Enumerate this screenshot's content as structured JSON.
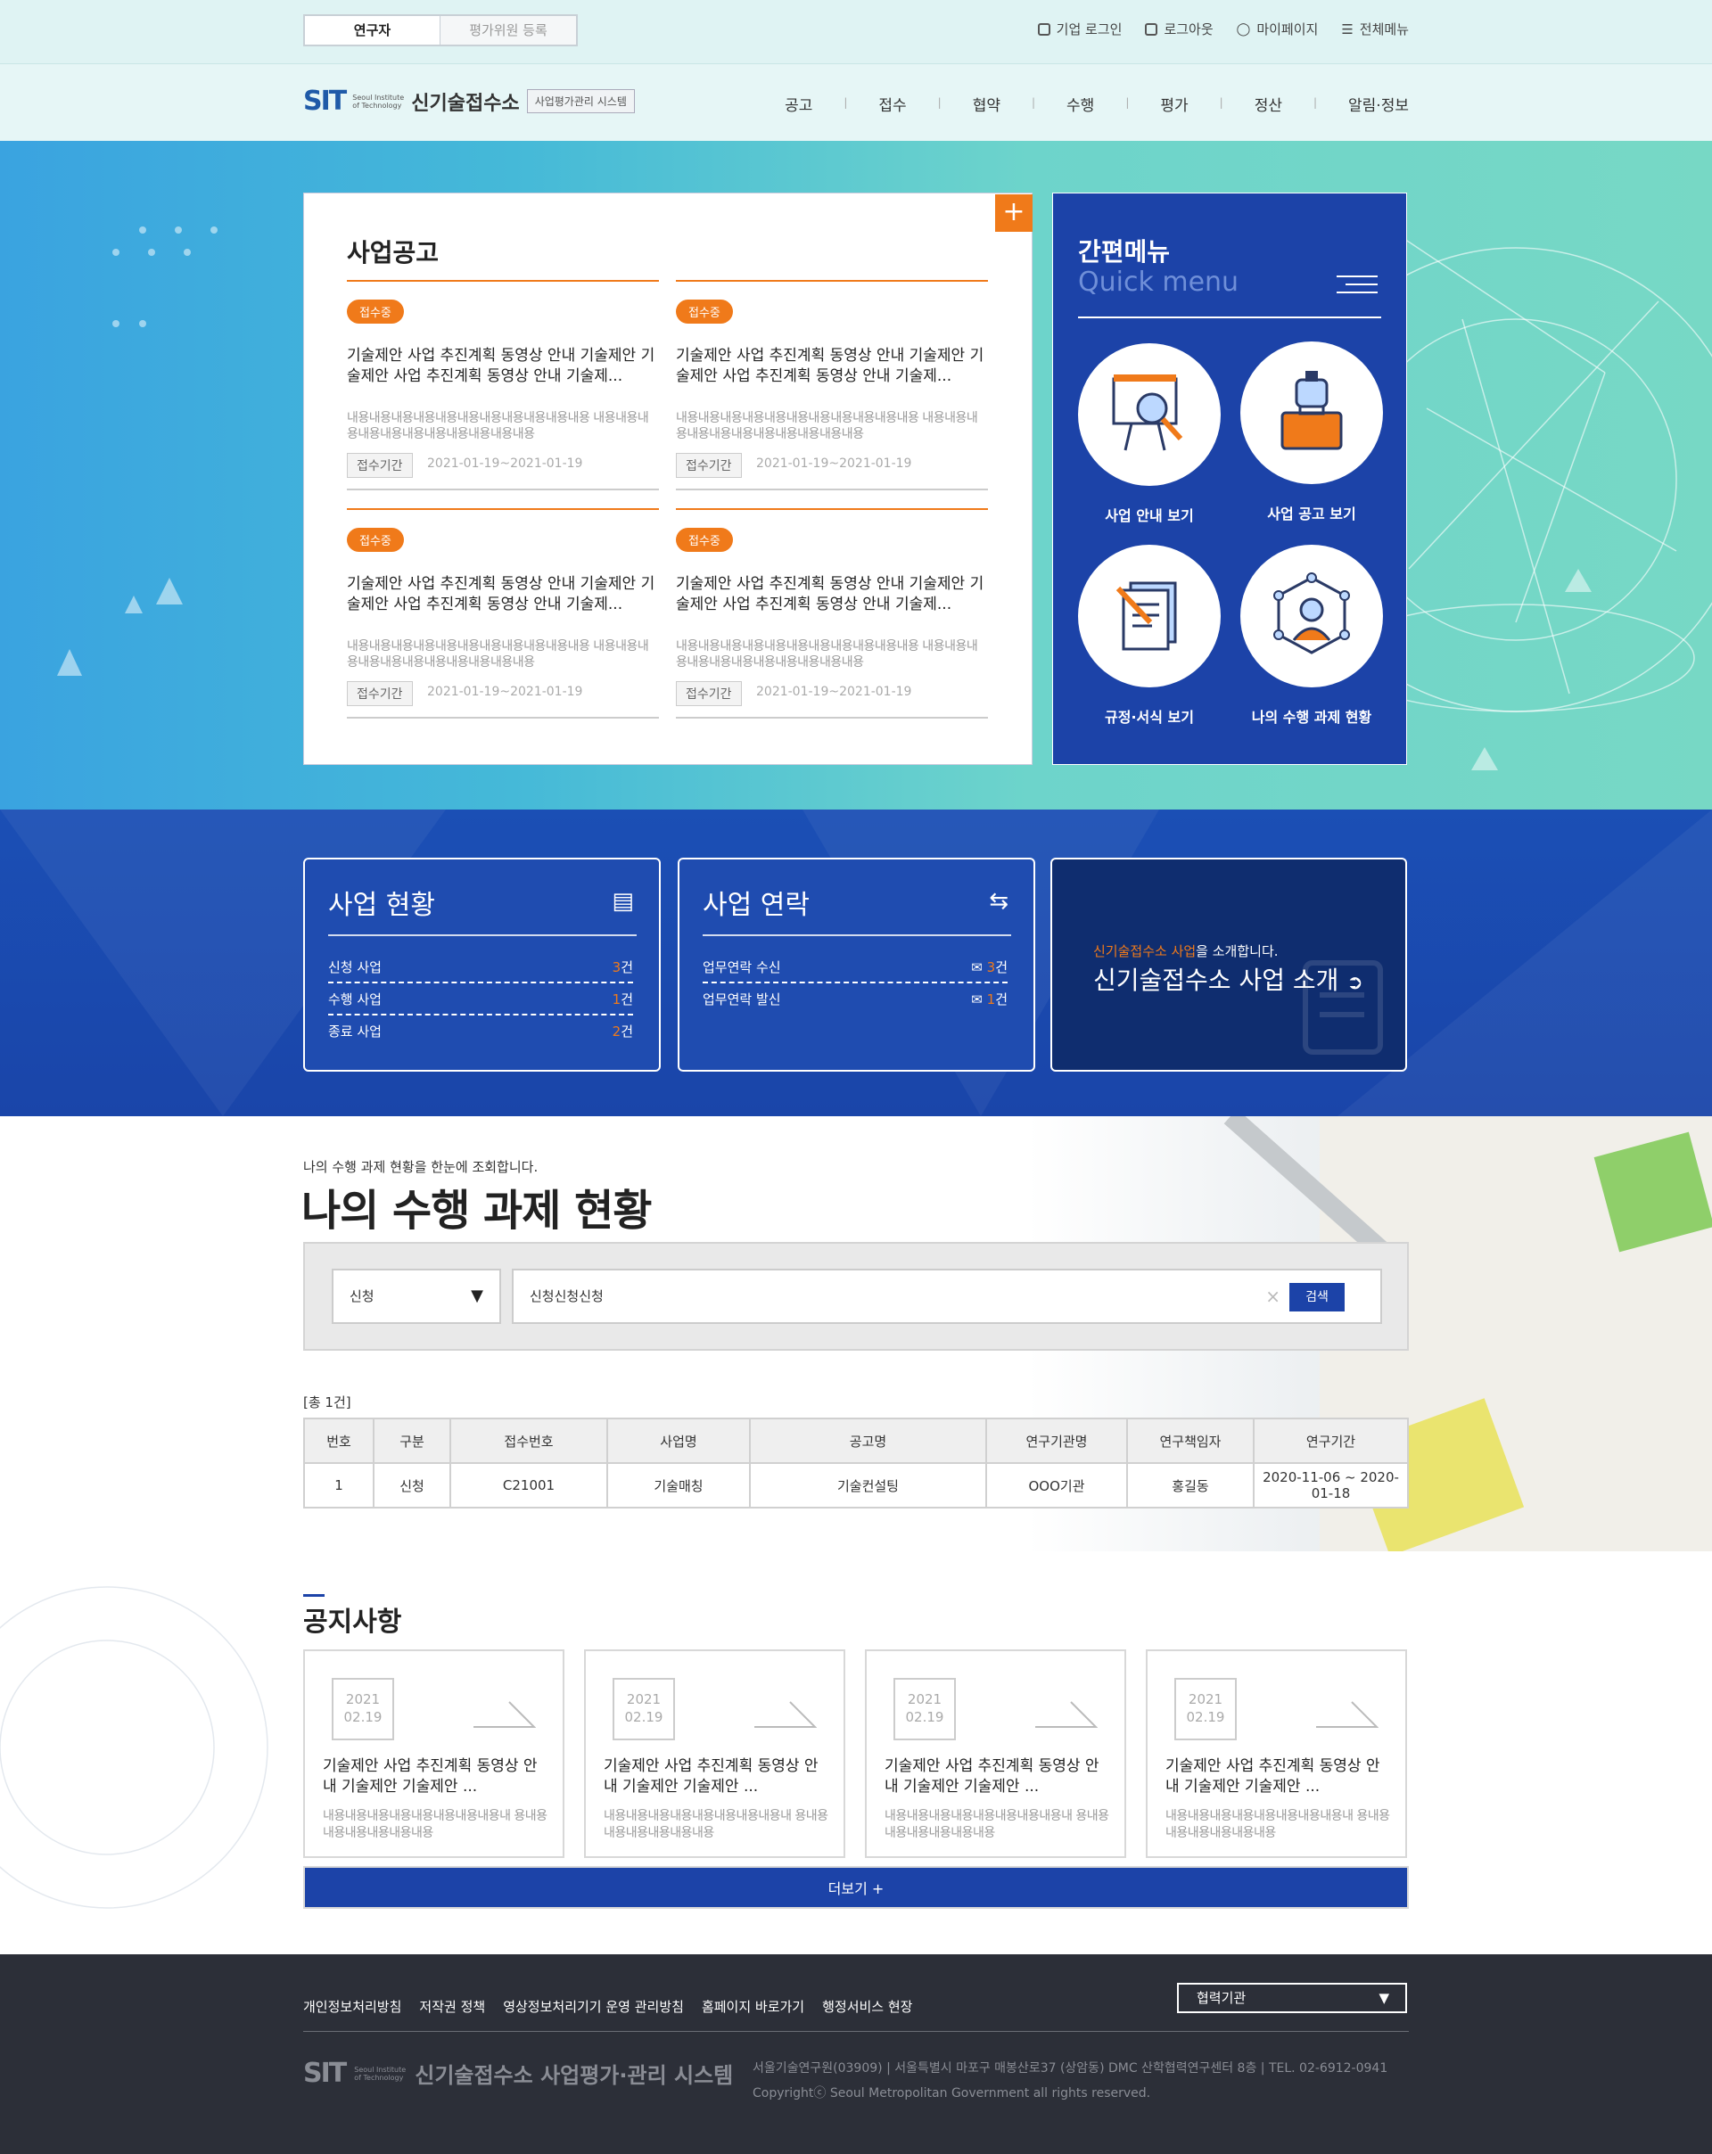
{
  "header": {
    "toggle": [
      "연구자",
      "평가위원 등록"
    ],
    "util": [
      "기업 로그인",
      "로그아웃",
      "마이페이지",
      "전체메뉴"
    ],
    "logo_mark": "SIT",
    "logo_sub": "Seoul Institute of Technology",
    "logo_name": "신기술접수소",
    "logo_tag": "사업평가관리 시스템",
    "gnb": [
      "공고",
      "접수",
      "협약",
      "수행",
      "평가",
      "정산",
      "알림·정보"
    ]
  },
  "notice_board": {
    "title": "사업공고",
    "plus": "+",
    "items": [
      {
        "badge": "접수중",
        "title": "기술제안 사업 추진계획 동영상 안내 기술제안 기술제안 사업 추진계획 동영상 안내 기술제...",
        "desc": "내용내용내용내용내용내용내용내용내용내용내용 내용내용내용내용내용내용내용내용내용내용내용",
        "tag": "접수기간",
        "date": "2021-01-19~2021-01-19"
      },
      {
        "badge": "접수중",
        "title": "기술제안 사업 추진계획 동영상 안내 기술제안 기술제안 사업 추진계획 동영상 안내 기술제...",
        "desc": "내용내용내용내용내용내용내용내용내용내용내용 내용내용내용내용내용내용내용내용내용내용내용",
        "tag": "접수기간",
        "date": "2021-01-19~2021-01-19"
      },
      {
        "badge": "접수중",
        "title": "기술제안 사업 추진계획 동영상 안내 기술제안 기술제안 사업 추진계획 동영상 안내 기술제...",
        "desc": "내용내용내용내용내용내용내용내용내용내용내용 내용내용내용내용내용내용내용내용내용내용내용",
        "tag": "접수기간",
        "date": "2021-01-19~2021-01-19"
      },
      {
        "badge": "접수중",
        "title": "기술제안 사업 추진계획 동영상 안내 기술제안 기술제안 사업 추진계획 동영상 안내 기술제...",
        "desc": "내용내용내용내용내용내용내용내용내용내용내용 내용내용내용내용내용내용내용내용내용내용내용",
        "tag": "접수기간",
        "date": "2021-01-19~2021-01-19"
      }
    ]
  },
  "quick_menu": {
    "title": "간편메뉴",
    "subtitle": "Quick menu",
    "items": [
      "사업 안내 보기",
      "사업 공고 보기",
      "규정·서식 보기",
      "나의 수행 과제 현황"
    ]
  },
  "status": {
    "business": {
      "title": "사업 현황",
      "rows": [
        {
          "label": "신청 사업",
          "count": "3",
          "unit": "건"
        },
        {
          "label": "수행 사업",
          "count": "1",
          "unit": "건"
        },
        {
          "label": "종료 사업",
          "count": "2",
          "unit": "건"
        }
      ]
    },
    "contact": {
      "title": "사업 연락",
      "rows": [
        {
          "label": "업무연락 수신",
          "count": "3",
          "unit": "건"
        },
        {
          "label": "업무연락 발신",
          "count": "1",
          "unit": "건"
        }
      ]
    },
    "intro": {
      "highlight": "신기술접수소 사업",
      "small": "을 소개합니다.",
      "big": "신기술접수소 사업 소개"
    }
  },
  "task": {
    "subtitle": "나의 수행 과제 현황을 한눈에 조회합니다.",
    "title": "나의 수행 과제 현황",
    "select_value": "신청",
    "search_value": "신청신청신청",
    "search_button": "검색",
    "total": "[총 1건]",
    "columns": [
      "번호",
      "구분",
      "접수번호",
      "사업명",
      "공고명",
      "연구기관명",
      "연구책임자",
      "연구기간"
    ],
    "rows": [
      [
        "1",
        "신청",
        "C21001",
        "기술매칭",
        "기술컨설팅",
        "OOO기관",
        "홍길동",
        "2020-11-06 ~ 2020-01-18"
      ]
    ]
  },
  "notices": {
    "title": "공지사항",
    "items": [
      {
        "year": "2021",
        "date": "02.19",
        "title": "기술제안 사업 추진계획 동영상 안내 기술제안 기술제안 ...",
        "desc": "내용내용내용내용내용내용내용내용내 용내용내용내용내용내용내용"
      },
      {
        "year": "2021",
        "date": "02.19",
        "title": "기술제안 사업 추진계획 동영상 안내 기술제안 기술제안 ...",
        "desc": "내용내용내용내용내용내용내용내용내 용내용내용내용내용내용내용"
      },
      {
        "year": "2021",
        "date": "02.19",
        "title": "기술제안 사업 추진계획 동영상 안내 기술제안 기술제안 ...",
        "desc": "내용내용내용내용내용내용내용내용내 용내용내용내용내용내용내용"
      },
      {
        "year": "2021",
        "date": "02.19",
        "title": "기술제안 사업 추진계획 동영상 안내 기술제안 기술제안 ...",
        "desc": "내용내용내용내용내용내용내용내용내 용내용내용내용내용내용내용"
      }
    ],
    "more": "더보기 +"
  },
  "footer": {
    "links": [
      "개인정보처리방침",
      "저작권 정책",
      "영상정보처리기기 운영 관리방침",
      "홈페이지 바로가기",
      "행정서비스 현장"
    ],
    "select": "협력기관",
    "name": "신기술접수소 사업평가·관리 시스템",
    "address": "서울기술연구원(03909) | 서울특별시 마포구 매봉산로37 (상암동) DMC 산학협력연구센터 8층 | TEL. 02-6912-0941",
    "copyright": "Copyrightⓒ Seoul Metropolitan Government all rights reserved."
  },
  "colors": {
    "primary": "#1c43a8",
    "accent": "#f07a1a",
    "footer": "#2c2f38"
  }
}
